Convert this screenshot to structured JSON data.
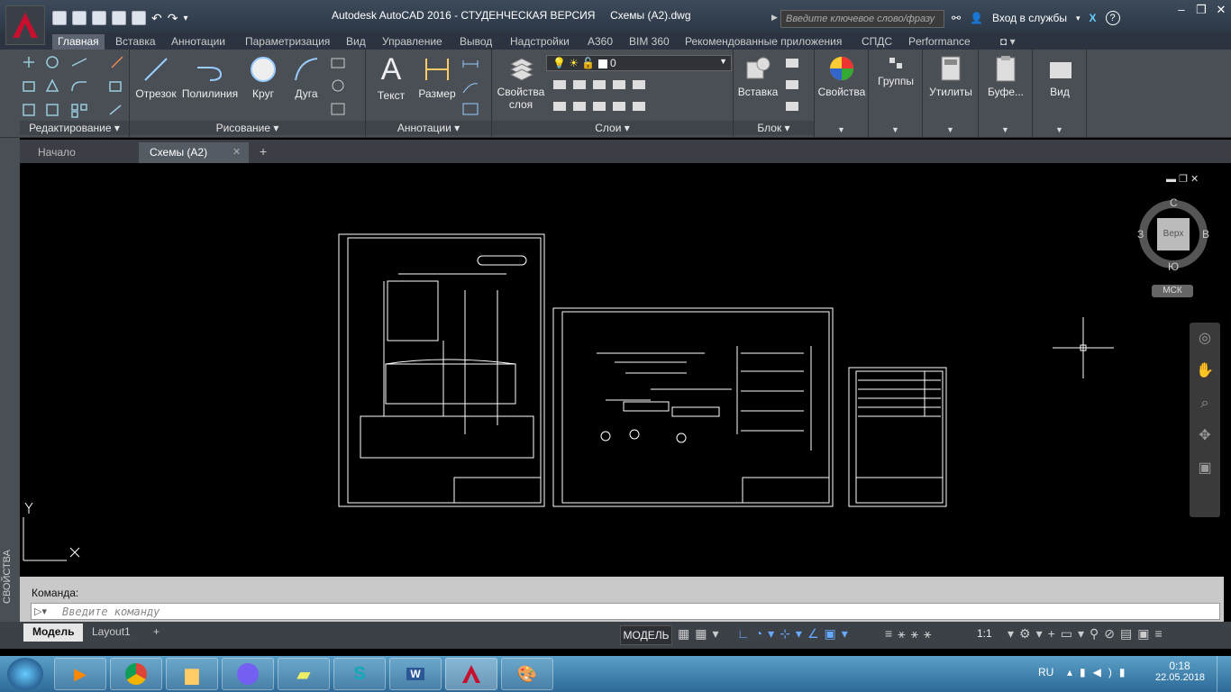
{
  "title": {
    "app": "Autodesk AutoCAD 2016 - СТУДЕНЧЕСКАЯ ВЕРСИЯ",
    "file": "Схемы (А2).dwg",
    "search_placeholder": "Введите ключевое слово/фразу",
    "sign_in": "Вход в службы",
    "help": "?"
  },
  "ribbon_tabs": [
    "Главная",
    "Вставка",
    "Аннотации",
    "Параметризация",
    "Вид",
    "Управление",
    "Вывод",
    "Надстройки",
    "A360",
    "BIM 360",
    "Рекомендованные приложения",
    "СПДС",
    "Performance"
  ],
  "panels": {
    "edit": "Редактирование",
    "draw": "Рисование",
    "annot": "Аннотации",
    "layers": "Слои",
    "block": "Блок"
  },
  "buttons": {
    "line": "Отрезок",
    "polyline": "Полилиния",
    "circle": "Круг",
    "arc": "Дуга",
    "text": "Текст",
    "dimension": "Размер",
    "layer_props": "Свойства слоя",
    "insert": "Вставка",
    "properties": "Свойства",
    "groups": "Группы",
    "utilities": "Утилиты",
    "clipboard": "Буфе...",
    "view": "Вид"
  },
  "layer_current": "0",
  "doc_tabs": {
    "start": "Начало",
    "current": "Схемы (А2)"
  },
  "viewcube": {
    "top": "Верх",
    "n": "С",
    "s": "Ю",
    "w": "З",
    "e": "В",
    "ucs": "МСК"
  },
  "side_palette": "СВОЙСТВА",
  "command": {
    "label": "Команда:",
    "placeholder": "Введите команду"
  },
  "status": {
    "model_tab": "Модель",
    "layout_tab": "Layout1",
    "mode": "МОДЕЛЬ",
    "scale": "1:1"
  },
  "taskbar": {
    "lang": "RU",
    "time": "0:18",
    "date": "22.05.2018"
  },
  "colors": {
    "accent": "#c8102e",
    "ribbon": "#4a4e55",
    "canvas": "#000000"
  }
}
